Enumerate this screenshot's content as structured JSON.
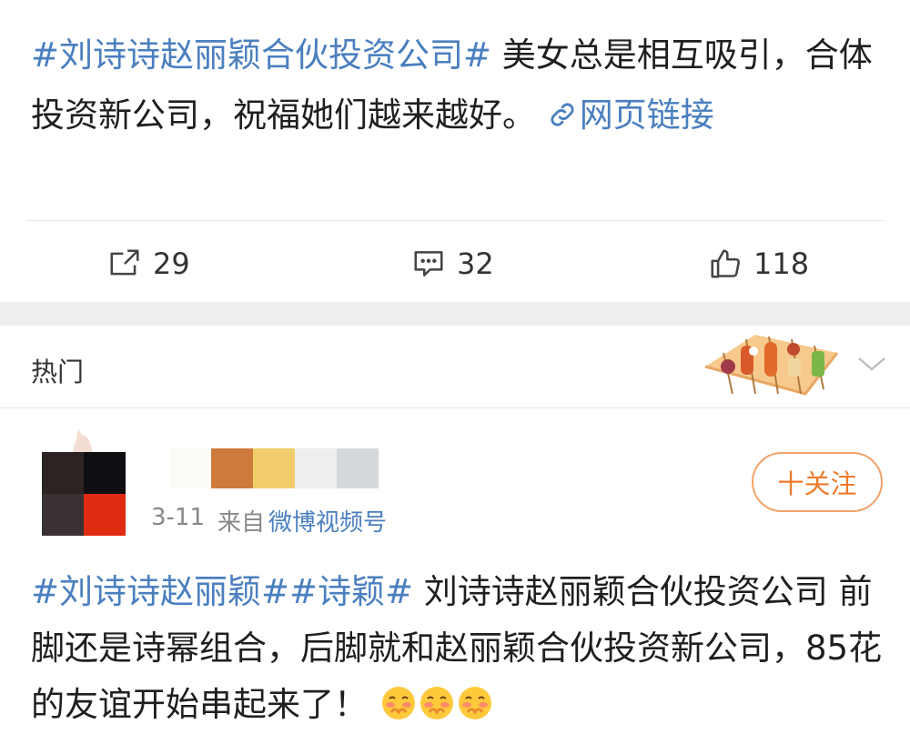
{
  "post1": {
    "hashtag": "#刘诗诗赵丽颖合伙投资公司#",
    "text": " 美女总是相互吸引，合体投资新公司，祝福她们越来越好。",
    "link_label": "网页链接"
  },
  "actions": {
    "repost_count": "29",
    "comment_count": "32",
    "like_count": "118",
    "repost_icon": "repost-icon",
    "comment_icon": "comment-icon",
    "like_icon": "like-icon"
  },
  "hot_section": {
    "label": "热门"
  },
  "comment_post": {
    "date": "3-11",
    "from_label": "来自",
    "source": "微博视频号",
    "follow_label": "十关注",
    "hashtag1": "#刘诗诗赵丽颖#",
    "hashtag2": "#诗颖#",
    "text": " 刘诗诗赵丽颖合伙投资公司 前脚还是诗幂组合，后脚就和赵丽颖合伙投资新公司，85花的友谊开始串起来了！",
    "emoji_count": 3
  },
  "colors": {
    "link_blue": "#4a7fbf",
    "follow_orange": "#ee7b2b",
    "band_gray": "#efefef"
  }
}
